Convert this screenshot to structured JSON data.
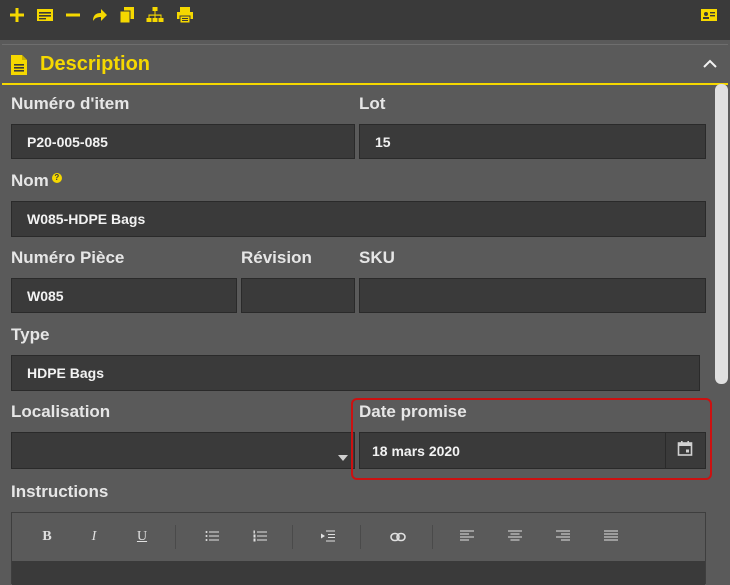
{
  "toolbar": {
    "icons": [
      "plus-icon",
      "card-icon",
      "minus-icon",
      "share-icon",
      "copy-icon",
      "hierarchy-icon",
      "print-icon",
      "id-card-icon"
    ]
  },
  "section": {
    "title": "Description"
  },
  "fields": {
    "item_number": {
      "label": "Numéro d'item",
      "value": "P20-005-085"
    },
    "lot": {
      "label": "Lot",
      "value": "15"
    },
    "name": {
      "label": "Nom",
      "value": "W085-HDPE Bags",
      "help": "?"
    },
    "part_number": {
      "label": "Numéro Pièce",
      "value": "W085"
    },
    "revision": {
      "label": "Révision",
      "value": ""
    },
    "sku": {
      "label": "SKU",
      "value": ""
    },
    "type": {
      "label": "Type",
      "value": "HDPE Bags"
    },
    "location": {
      "label": "Localisation",
      "value": ""
    },
    "promised_date": {
      "label": "Date promise",
      "value": "18 mars 2020"
    },
    "instructions": {
      "label": "Instructions"
    }
  },
  "editor": {
    "buttons": {
      "bold": "B",
      "italic": "I",
      "underline": "U"
    }
  },
  "colors": {
    "accent": "#f5d800",
    "highlight": "#cc1111",
    "field_bg": "#3a3a3a",
    "panel_bg": "#5a5a5a"
  }
}
